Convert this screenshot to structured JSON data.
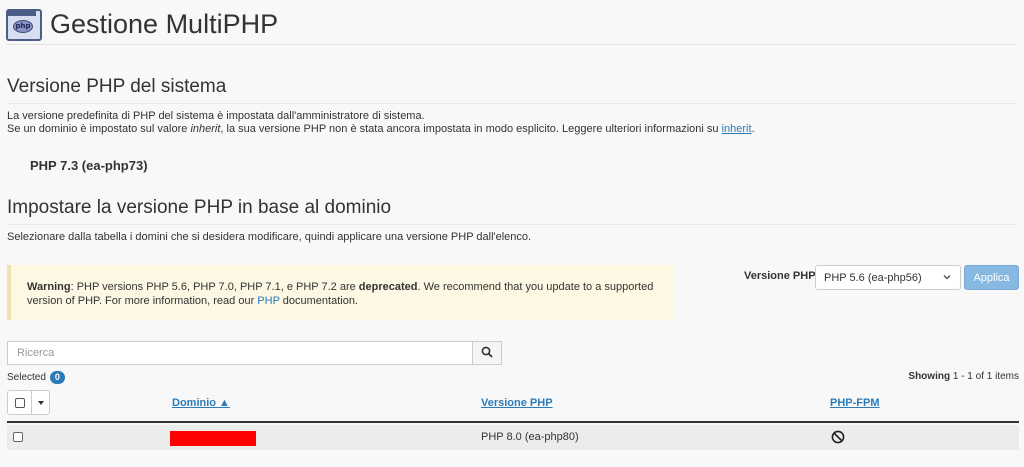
{
  "header": {
    "title": "Gestione MultiPHP",
    "icon": "php-window-icon",
    "icon_text": "php"
  },
  "system": {
    "heading": "Versione PHP del sistema",
    "desc1": "La versione predefinita di PHP del sistema è impostata dall'amministratore di sistema.",
    "desc2_a": "Se un dominio è impostato sul valore ",
    "desc2_italic": "inherit",
    "desc2_b": ", la sua versione PHP non è stata ancora impostata in modo esplicito. Leggere ulteriori informazioni su ",
    "desc2_link": "inherit",
    "desc2_end": ".",
    "current_version": "PHP 7.3 (ea-php73)"
  },
  "domain_section": {
    "heading": "Impostare la versione PHP in base al dominio",
    "desc": "Selezionare dalla tabella i domini che si desidera modificare, quindi applicare una versione PHP dall'elenco."
  },
  "warning": {
    "label": "Warning",
    "text_a": ": PHP versions PHP 5.6, PHP 7.0, PHP 7.1, e PHP 7.2 are ",
    "deprecated": "deprecated",
    "text_b": ". We recommend that you update to a supported version of PHP. For more information, read our ",
    "link": "PHP",
    "text_c": " documentation."
  },
  "version_picker": {
    "label": "Versione PHP",
    "selected": "PHP 5.6 (ea-php56)",
    "apply_label": "Applica",
    "apply_color": "#86b8e2"
  },
  "search": {
    "placeholder": "Ricerca",
    "icon": "search-icon"
  },
  "selection": {
    "label": "Selected",
    "count": "0"
  },
  "pagination": {
    "label": "Showing",
    "range": "1 - 1 of 1 items"
  },
  "table": {
    "columns": {
      "domain": "Dominio ▲",
      "version": "Versione PHP",
      "fpm": "PHP-FPM"
    },
    "rows": [
      {
        "domain": "[redacted]",
        "version": "PHP 8.0 (ea-php80)",
        "fpm_icon": "disabled-icon"
      }
    ]
  },
  "colors": {
    "link": "#2b7bb9",
    "warning_bg": "#fcf8e3",
    "redaction": "#ff0000"
  }
}
